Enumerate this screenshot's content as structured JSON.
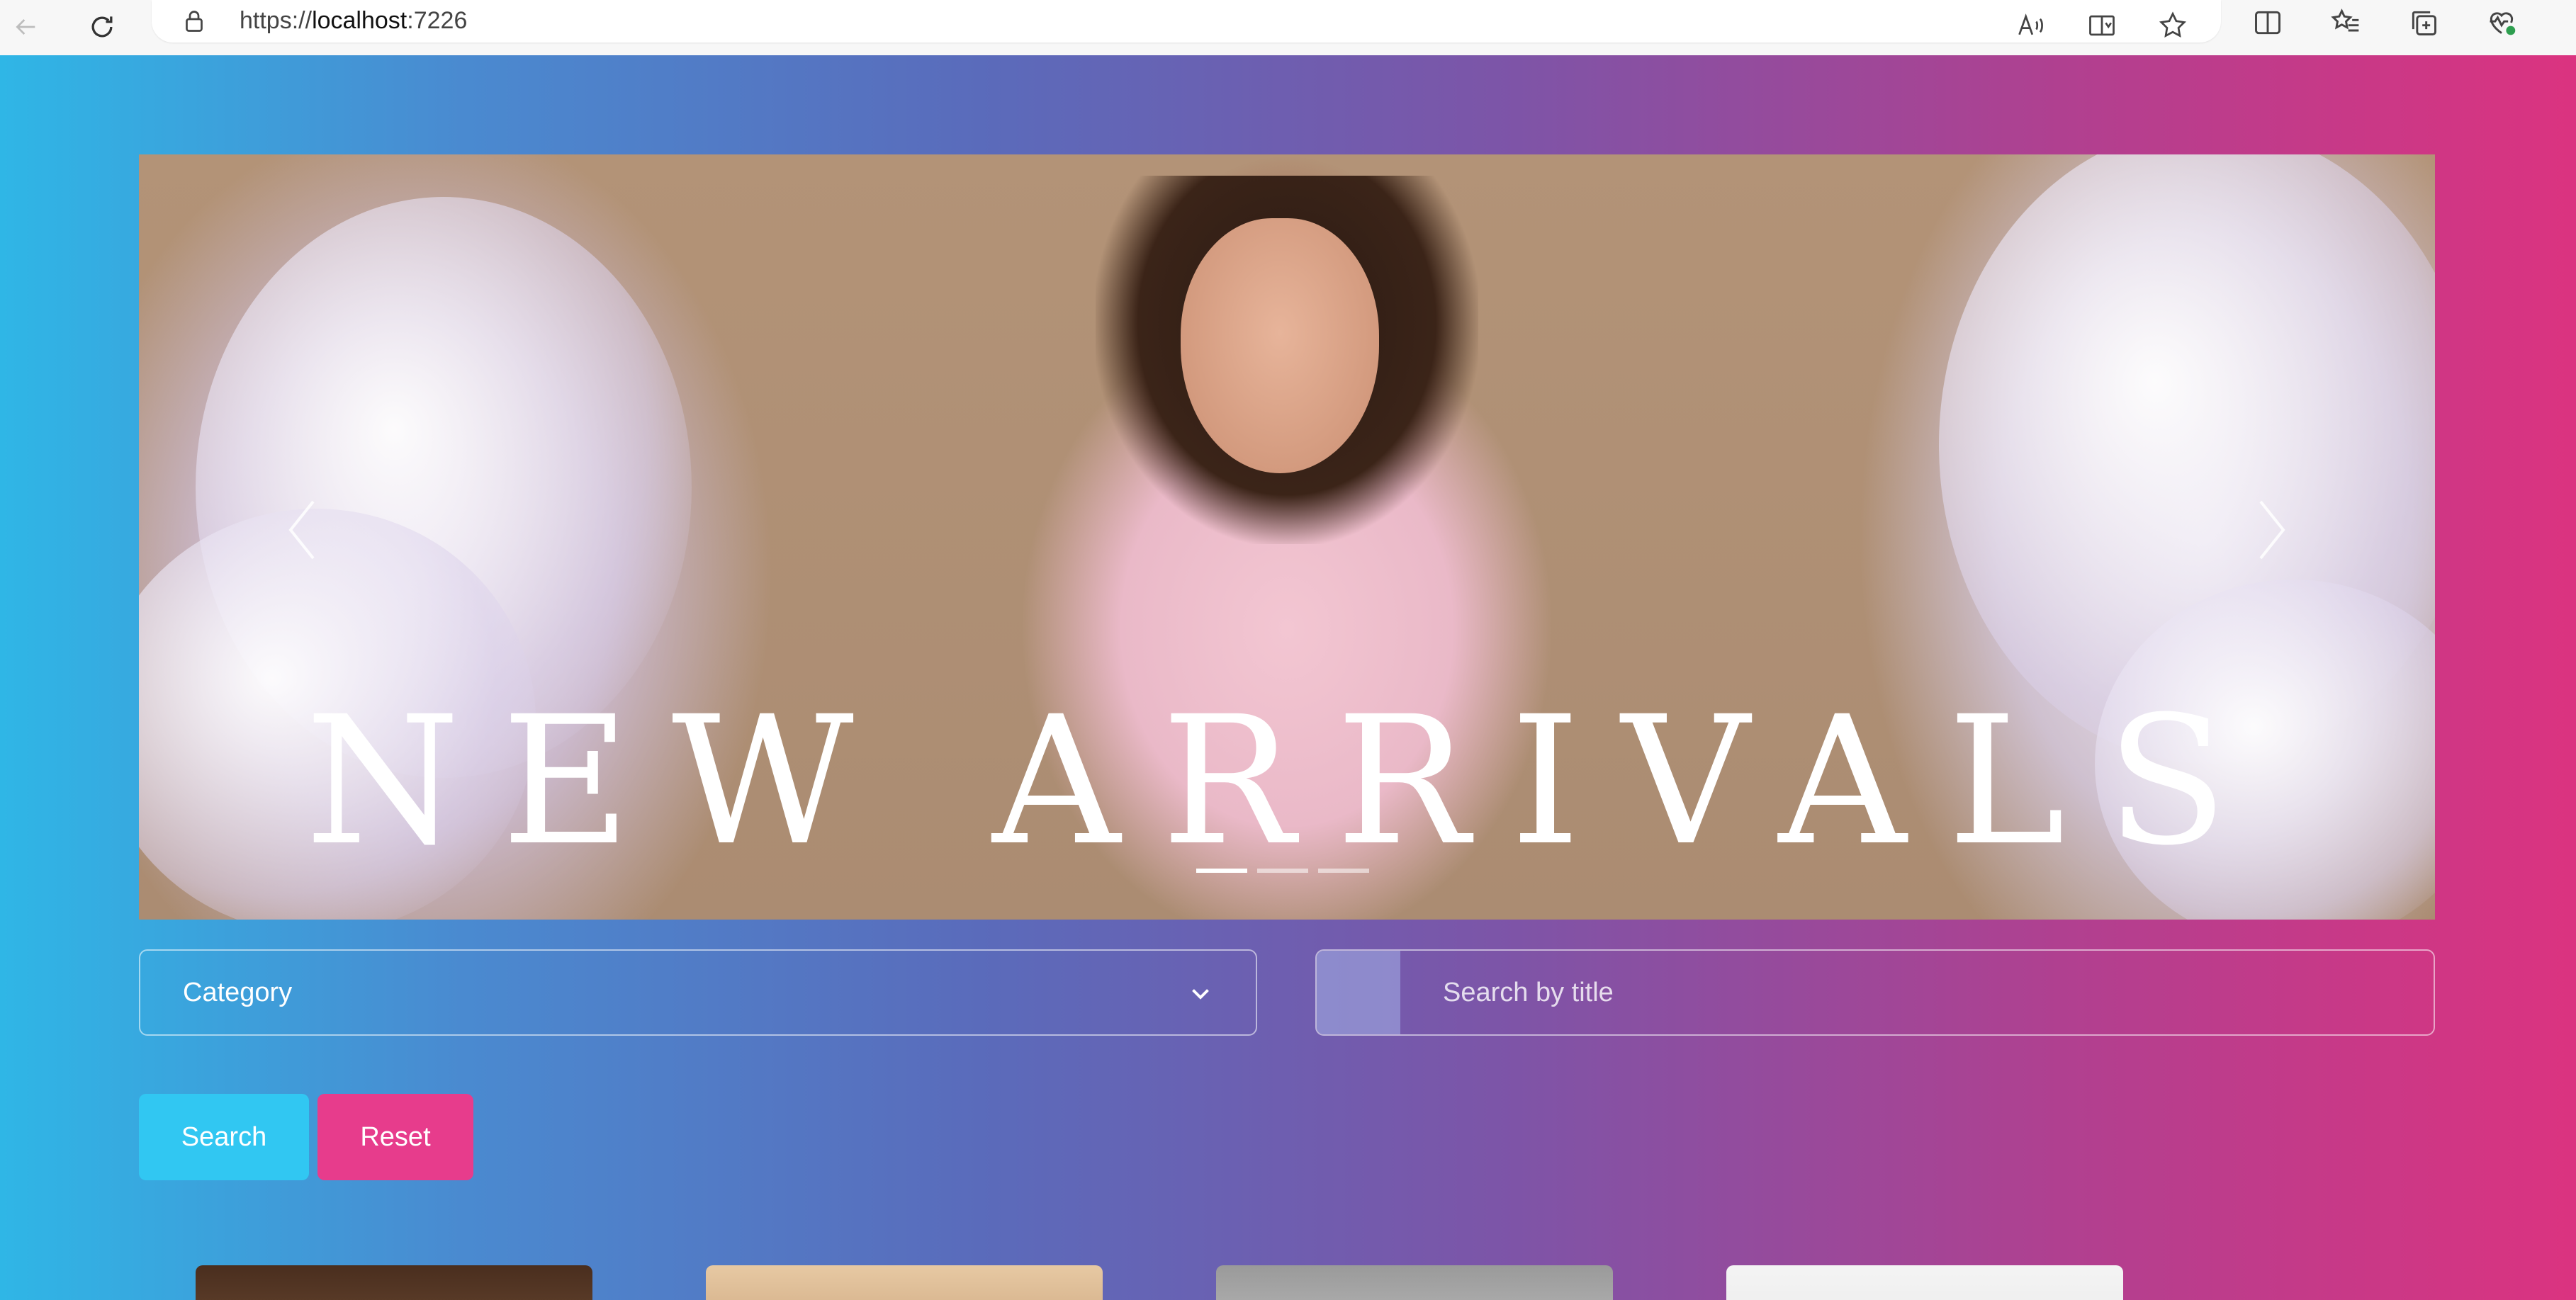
{
  "browser": {
    "url_scheme": "https://",
    "url_host": "localhost",
    "url_port": ":7226",
    "icons": [
      "back-icon",
      "refresh-icon",
      "lock-icon",
      "read-aloud-icon",
      "immersive-reader-icon",
      "favorite-star-icon",
      "split-screen-icon",
      "favorites-icon",
      "collections-icon",
      "browser-essentials-icon"
    ]
  },
  "carousel": {
    "headline": "NEW ARRIVALS",
    "slide_count": 3,
    "active_slide": 1
  },
  "filters": {
    "category_label": "Category",
    "search_placeholder": "Search by title"
  },
  "actions": {
    "search_label": "Search",
    "reset_label": "Reset"
  },
  "colors": {
    "gradient_start": "#2fb6e6",
    "gradient_end": "#db3380",
    "search_button": "#31c7f2",
    "reset_button": "#e73c8c"
  }
}
